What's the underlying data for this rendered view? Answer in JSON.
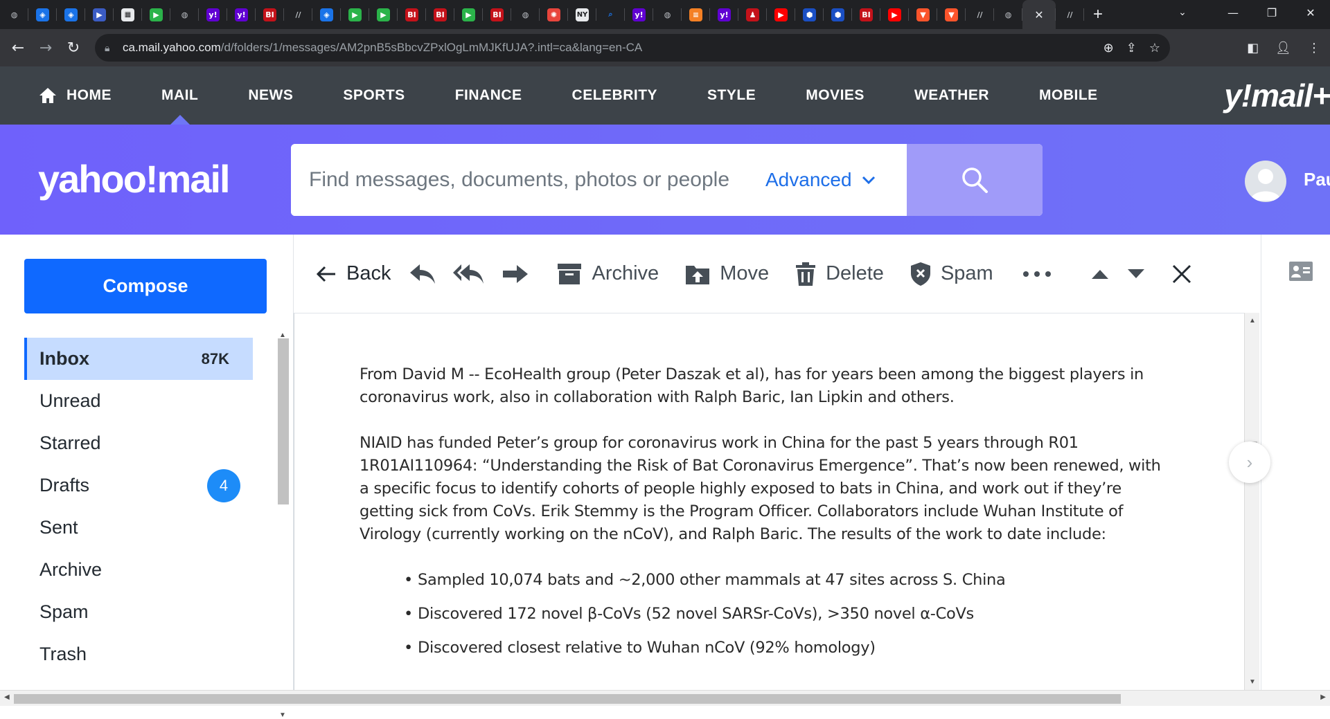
{
  "browser": {
    "tabs": [
      {
        "icon": "globe-icon",
        "color": "#5f6368",
        "glyph": "◍"
      },
      {
        "icon": "shield-icon",
        "color": "#1a73e8",
        "glyph": "◈"
      },
      {
        "icon": "shield-icon",
        "color": "#1a73e8",
        "glyph": "◈"
      },
      {
        "icon": "video-icon",
        "color": "#3b5cc4",
        "glyph": "▶"
      },
      {
        "icon": "grid-icon",
        "color": "#e8eaed",
        "glyph": "▦"
      },
      {
        "icon": "play-icon",
        "color": "#2bb34a",
        "glyph": "▶"
      },
      {
        "icon": "globe-icon",
        "color": "#5f6368",
        "glyph": "◍"
      },
      {
        "icon": "yahoo-icon",
        "color": "#6001d2",
        "glyph": "y!"
      },
      {
        "icon": "yahoo-icon",
        "color": "#6001d2",
        "glyph": "y!"
      },
      {
        "icon": "bi-icon",
        "color": "#c4121a",
        "glyph": "BI"
      },
      {
        "icon": "substack-icon",
        "color": "#5f6368",
        "glyph": "//"
      },
      {
        "icon": "shield-icon",
        "color": "#1a73e8",
        "glyph": "◈"
      },
      {
        "icon": "play-icon",
        "color": "#2bb34a",
        "glyph": "▶"
      },
      {
        "icon": "play-icon",
        "color": "#2bb34a",
        "glyph": "▶"
      },
      {
        "icon": "bi-icon",
        "color": "#c4121a",
        "glyph": "BI"
      },
      {
        "icon": "bi-icon",
        "color": "#c4121a",
        "glyph": "BI"
      },
      {
        "icon": "play-icon",
        "color": "#2bb34a",
        "glyph": "▶"
      },
      {
        "icon": "bi-icon",
        "color": "#c4121a",
        "glyph": "BI"
      },
      {
        "icon": "globe-icon",
        "color": "#5f6368",
        "glyph": "◍"
      },
      {
        "icon": "burst-icon",
        "color": "#e8453c",
        "glyph": "✺"
      },
      {
        "icon": "news-icon",
        "color": "#e8eaed",
        "glyph": "NY"
      },
      {
        "icon": "search-icon",
        "color": "#1a73e8",
        "glyph": "⌕"
      },
      {
        "icon": "yahoo-icon",
        "color": "#6001d2",
        "glyph": "y!"
      },
      {
        "icon": "globe-icon",
        "color": "#5f6368",
        "glyph": "◍"
      },
      {
        "icon": "stack-icon",
        "color": "#f48024",
        "glyph": "≡"
      },
      {
        "icon": "yahoo-icon",
        "color": "#6001d2",
        "glyph": "y!"
      },
      {
        "icon": "rumble-icon",
        "color": "#c4121a",
        "glyph": "♟"
      },
      {
        "icon": "youtube-icon",
        "color": "#ff0000",
        "glyph": "▶"
      },
      {
        "icon": "cube-icon",
        "color": "#1a4fc4",
        "glyph": "⬢"
      },
      {
        "icon": "cube-icon",
        "color": "#1a4fc4",
        "glyph": "⬢"
      },
      {
        "icon": "bi-icon",
        "color": "#c4121a",
        "glyph": "BI"
      },
      {
        "icon": "youtube-icon",
        "color": "#ff0000",
        "glyph": "▶"
      },
      {
        "icon": "brave-icon",
        "color": "#fb542b",
        "glyph": "▼"
      },
      {
        "icon": "brave-icon",
        "color": "#fb542b",
        "glyph": "▼"
      },
      {
        "icon": "substack-icon",
        "color": "#5f6368",
        "glyph": "//"
      },
      {
        "icon": "globe-icon",
        "color": "#5f6368",
        "glyph": "◍"
      }
    ],
    "active_tab_close": "✕",
    "trailing_tab": {
      "icon": "substack-icon",
      "color": "#5f6368",
      "glyph": "//"
    },
    "new_tab": "+",
    "url_host": "ca.mail.yahoo.com",
    "url_path": "/d/folders/1/messages/AM2pnB5sBbcvZPxlOgLmMJKfUJA?.intl=ca&lang=en-CA"
  },
  "topnav": {
    "items": [
      "HOME",
      "MAIL",
      "NEWS",
      "SPORTS",
      "FINANCE",
      "CELEBRITY",
      "STYLE",
      "MOVIES",
      "WEATHER",
      "MOBILE"
    ],
    "active": "MAIL",
    "brand": "y!mail+"
  },
  "header": {
    "logo": "yahoo!mail",
    "search_placeholder": "Find messages, documents, photos or people",
    "advanced_label": "Advanced",
    "user_name": "Pau"
  },
  "sidebar": {
    "compose_label": "Compose",
    "folders": [
      {
        "name": "Inbox",
        "count": "87K",
        "active": true
      },
      {
        "name": "Unread"
      },
      {
        "name": "Starred"
      },
      {
        "name": "Drafts",
        "badge": "4"
      },
      {
        "name": "Sent"
      },
      {
        "name": "Archive"
      },
      {
        "name": "Spam"
      },
      {
        "name": "Trash"
      }
    ]
  },
  "toolbar": {
    "back_label": "Back",
    "archive_label": "Archive",
    "move_label": "Move",
    "delete_label": "Delete",
    "spam_label": "Spam"
  },
  "message": {
    "paragraphs": [
      "From David M --  EcoHealth group (Peter Daszak et al), has for years been among the biggest players in coronavirus work, also in collaboration with Ralph Baric, Ian Lipkin and others.",
      "NIAID has  funded Peter’s group for coronavirus work in China for the past 5 years through R01 1R01AI110964: “Understanding the Risk of Bat Coronavirus Emergence”. That’s now been renewed, with a specific focus to identify cohorts of people highly exposed to bats in China, and work out if they’re getting sick from CoVs.  Erik Stemmy is the Program Officer. Collaborators include Wuhan Institute of Virology (currently working on the nCoV), and Ralph Baric.  The results of the work to date include:"
    ],
    "bullets": [
      "Sampled 10,074 bats and ~2,000 other mammals at 47 sites across S. China",
      "Discovered 172 novel β-CoVs (52 novel SARSr-CoVs), >350 novel α-CoVs",
      "Discovered closest relative to Wuhan nCoV (92% homology)"
    ]
  },
  "colors": {
    "nav_bg": "#3d4349",
    "header_bg": "#6f61fb",
    "accent_blue": "#0f69ff",
    "inbox_highlight": "#c6dcff"
  }
}
